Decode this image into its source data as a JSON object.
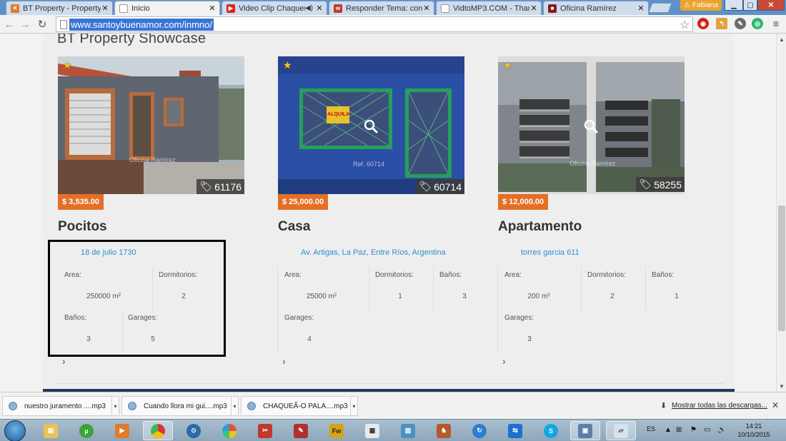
{
  "browser": {
    "tabs": [
      {
        "title": "BT Property - Property M",
        "active": false,
        "favicon_color": "#e07a2e"
      },
      {
        "title": "Inicio",
        "active": true,
        "favicon_color": "#ffffff"
      },
      {
        "title": "Video Clip Chaqueño",
        "active": false,
        "favicon_color": "#d9261c"
      },
      {
        "title": "Responder Tema: consul",
        "active": false,
        "favicon_color": "#c0392b"
      },
      {
        "title": "VidtoMP3.COM - Thanks",
        "active": false,
        "favicon_color": "#ffffff"
      },
      {
        "title": "Oficina Ramírez",
        "active": false,
        "favicon_color": "#8b1a1a"
      }
    ],
    "profile_name": "Fabiana",
    "url": "www.santoybuenamor.com/inmno/"
  },
  "page": {
    "section_title": "BT Property Showcase",
    "properties": [
      {
        "ref": "61176",
        "price": "$ 3,535.00",
        "title": "Pocitos",
        "address": "18 de julio 1730",
        "watermark": "Oficina Ramírez",
        "labels": {
          "area": "Area:",
          "dormitorios": "Dormitorios:",
          "banos": "Baños:",
          "garages": "Garages:"
        },
        "area": "250000 m²",
        "dormitorios": "2",
        "banos": "3",
        "garages": "5"
      },
      {
        "ref": "60714",
        "price": "$ 25,000.00",
        "title": "Casa",
        "address": "Av. Artigas, La Paz, Entre Ríos, Argentina",
        "watermark": "Ref. 60714",
        "sign_text": "ALQUILA",
        "labels": {
          "area": "Area:",
          "dormitorios": "Dormitorios:",
          "banos": "Baños:",
          "garages": "Garages:"
        },
        "area": "25000 m²",
        "dormitorios": "1",
        "banos": "3",
        "garages": "4"
      },
      {
        "ref": "58255",
        "price": "$ 12,000.00",
        "title": "Apartamento",
        "address": "torres garcia 611",
        "watermark": "Oficina Ramírez",
        "labels": {
          "area": "Area:",
          "dormitorios": "Dormitorios:",
          "banos": "Baños:",
          "garages": "Garages:"
        },
        "area": "200 m²",
        "dormitorios": "2",
        "banos": "1",
        "garages": "3"
      }
    ]
  },
  "downloads": {
    "items": [
      {
        "name": "nuestro juramento ....mp3"
      },
      {
        "name": "Cuando llora mi gui....mp3"
      },
      {
        "name": "CHAQUEÃ-O PALA....mp3"
      }
    ],
    "show_all": "Mostrar todas las descargas..."
  },
  "taskbar": {
    "language": "ES",
    "time": "14:21",
    "date": "10/10/2015"
  },
  "colors": {
    "price_badge": "#e46f25",
    "link": "#2a8fd2",
    "url_selection": "#3875d7",
    "highlight_box": "#000000"
  }
}
